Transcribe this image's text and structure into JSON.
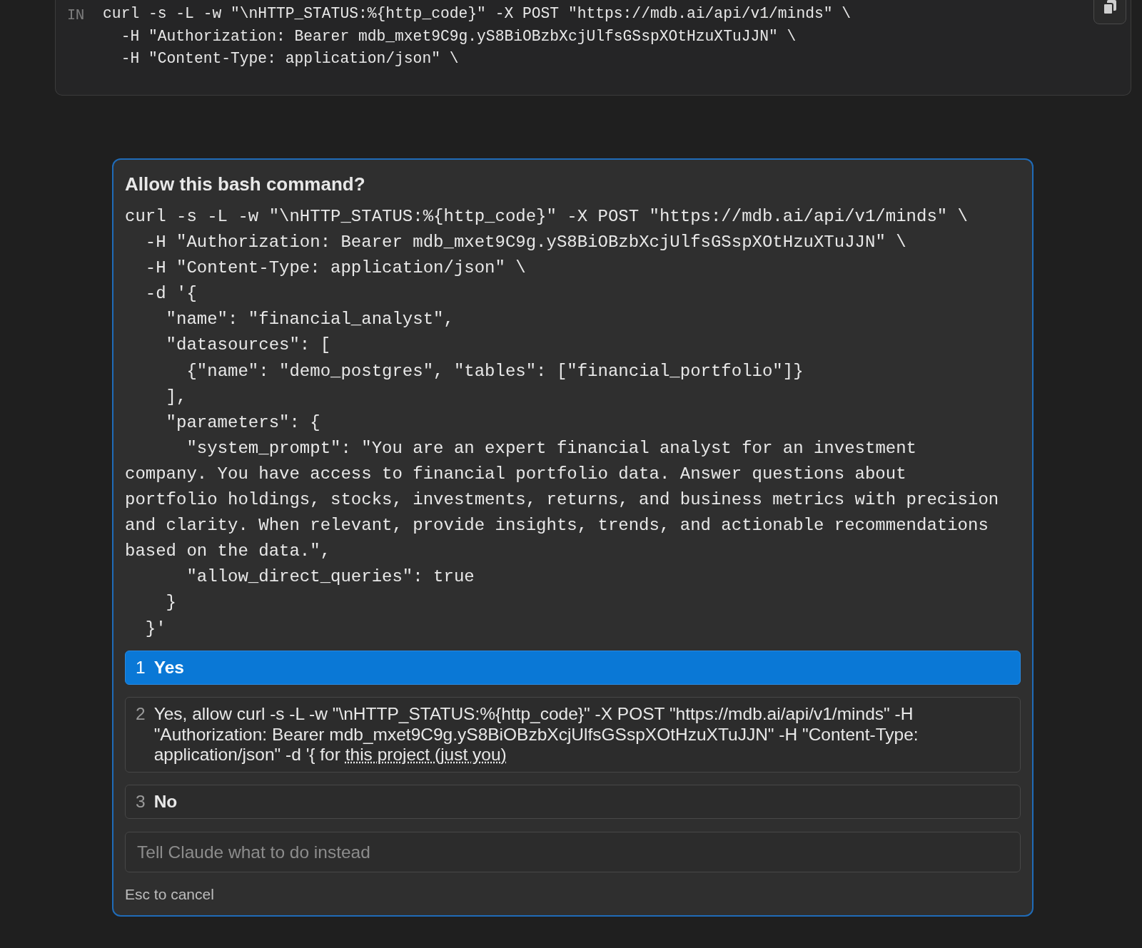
{
  "tool_call": {
    "label": "IN",
    "command_lines": [
      "curl -s -L -w \"\\nHTTP_STATUS:%{http_code}\" -X POST \"https://mdb.ai/api/v1/minds\" \\",
      "  -H \"Authorization: Bearer mdb_mxet9C9g.yS8BiOBzbXcjUlfsGSspXOtHzuXTuJJN\" \\",
      "  -H \"Content-Type: application/json\" \\"
    ]
  },
  "dialog": {
    "title": "Allow this bash command?",
    "command_lines": [
      "curl -s -L -w \"\\nHTTP_STATUS:%{http_code}\" -X POST \"https://mdb.ai/api/v1/minds\" \\",
      "  -H \"Authorization: Bearer mdb_mxet9C9g.yS8BiOBzbXcjUlfsGSspXOtHzuXTuJJN\" \\",
      "  -H \"Content-Type: application/json\" \\",
      "  -d '{",
      "    \"name\": \"financial_analyst\",",
      "    \"datasources\": [",
      "      {\"name\": \"demo_postgres\", \"tables\": [\"financial_portfolio\"]}",
      "    ],",
      "    \"parameters\": {",
      "      \"system_prompt\": \"You are an expert financial analyst for an investment company. You have access to financial portfolio data. Answer questions about portfolio holdings, stocks, investments, returns, and business metrics with precision and clarity. When relevant, provide insights, trends, and actionable recommendations based on the data.\",",
      "      \"allow_direct_queries\": true",
      "    }",
      "  }'"
    ],
    "options": [
      {
        "number": "1",
        "label": "Yes",
        "selected": true
      },
      {
        "number": "2",
        "label": "Yes, allow curl -s -L -w \"\\nHTTP_STATUS:%{http_code}\" -X POST \"https://mdb.ai/api/v1/minds\" -H \"Authorization: Bearer mdb_mxet9C9g.yS8BiOBzbXcjUlfsGSspXOtHzuXTuJJN\" -H \"Content-Type: application/json\" -d '{ for ",
        "link": "this project (just you)",
        "selected": false
      },
      {
        "number": "3",
        "label": "No",
        "selected": false
      }
    ],
    "input": {
      "placeholder": "Tell Claude what to do instead"
    },
    "hint": "Esc to cancel"
  }
}
